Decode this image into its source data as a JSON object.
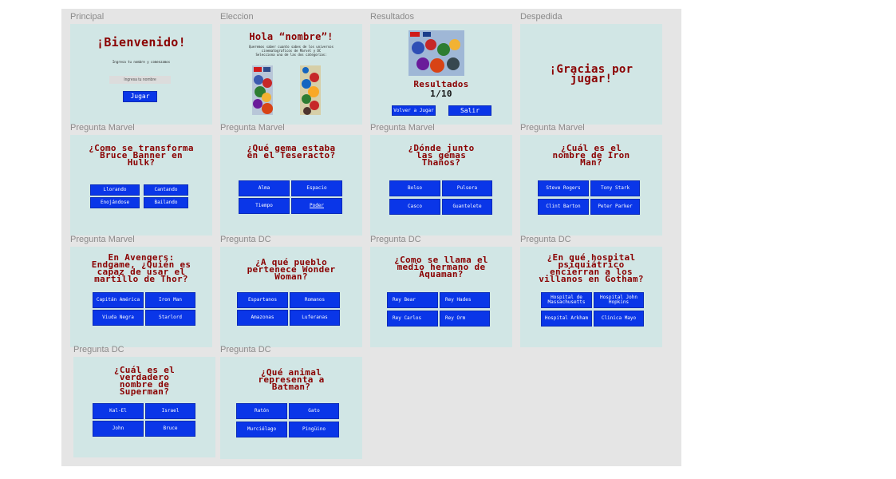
{
  "frames": {
    "principal": {
      "label": "Principal",
      "title": "¡Bienvenido!",
      "instruction": "Ingresa tu nombre y comenzamos",
      "input_placeholder": "Ingresa tu nombre",
      "button": "Jugar"
    },
    "eleccion": {
      "label": "Eleccion",
      "title": "Hola “nombre”!",
      "desc1": "Queremos saber cuanto sabes de los universos",
      "desc2": "cinematograficos de Marvel y DC",
      "desc3": "Selecciona una de las dos categorias:"
    },
    "resultados": {
      "label": "Resultados",
      "title": "Resultados",
      "score": "1/10",
      "btn_back": "Volver a Jugar",
      "btn_exit": "Salir"
    },
    "despedida": {
      "label": "Despedida",
      "title": "¡Gracias por jugar!"
    },
    "q1": {
      "label": "Pregunta Marvel",
      "question": "¿Como se transforma Bruce Banner en Hulk?",
      "options": [
        "Llorando",
        "Cantando",
        "Enojándose",
        "Bailando"
      ]
    },
    "q2": {
      "label": "Pregunta Marvel",
      "question": "¿Qué gema estaba en el Teseracto?",
      "options": [
        "Alma",
        "Espacio",
        "Tiempo",
        "Poder"
      ]
    },
    "q3": {
      "label": "Pregunta Marvel",
      "question": "¿Dónde junto las gemas Thanos?",
      "options": [
        "Bolso",
        "Pulsera",
        "Casco",
        "Guantelete"
      ]
    },
    "q4": {
      "label": "Pregunta Marvel",
      "question": "¿Cuál es el nombre de Iron Man?",
      "options": [
        "Steve Rogers",
        "Tony Stark",
        "Clint Barton",
        "Peter Parker"
      ]
    },
    "q5": {
      "label": "Pregunta Marvel",
      "question": "En Avengers: Endgame, ¿Quién es capaz de usar el martillo de Thor?",
      "options": [
        "Capitán América",
        "Iron Man",
        "Viuda Negra",
        "Starlord"
      ]
    },
    "q6": {
      "label": "Pregunta DC",
      "question": "¿A qué pueblo pertenece Wonder Woman?",
      "options": [
        "Espartanos",
        "Romanos",
        "Amazonas",
        "Luferanas"
      ]
    },
    "q7": {
      "label": "Pregunta DC",
      "question": "¿Como se llama el medio hermano de Aquaman?",
      "options": [
        "Rey Bear",
        "Rey Hades",
        "Rey Carlos",
        "Rey Orm"
      ]
    },
    "q8": {
      "label": "Pregunta DC",
      "question": "¿En qué hospital psiquiátrico encierran a los villanos en Gotham?",
      "options": [
        "Hospital de Massachusetts",
        "Hospital John Hopkins",
        "Hospital Arkham",
        "Clinica Mayo"
      ]
    },
    "q9": {
      "label": "Pregunta DC",
      "question": "¿Cuál es el verdadero nombre de Superman?",
      "options": [
        "Kal-El",
        "Israel",
        "John",
        "Bruce"
      ]
    },
    "q10": {
      "label": "Pregunta DC",
      "question": "¿Qué animal representa a Batman?",
      "options": [
        "Ratón",
        "Gato",
        "Murciélago",
        "Pingüino"
      ]
    }
  },
  "colors": {
    "card": "#d1e6e5",
    "title": "#8a0000",
    "button": "#0a36e8",
    "canvas": "#e5e5e5"
  }
}
